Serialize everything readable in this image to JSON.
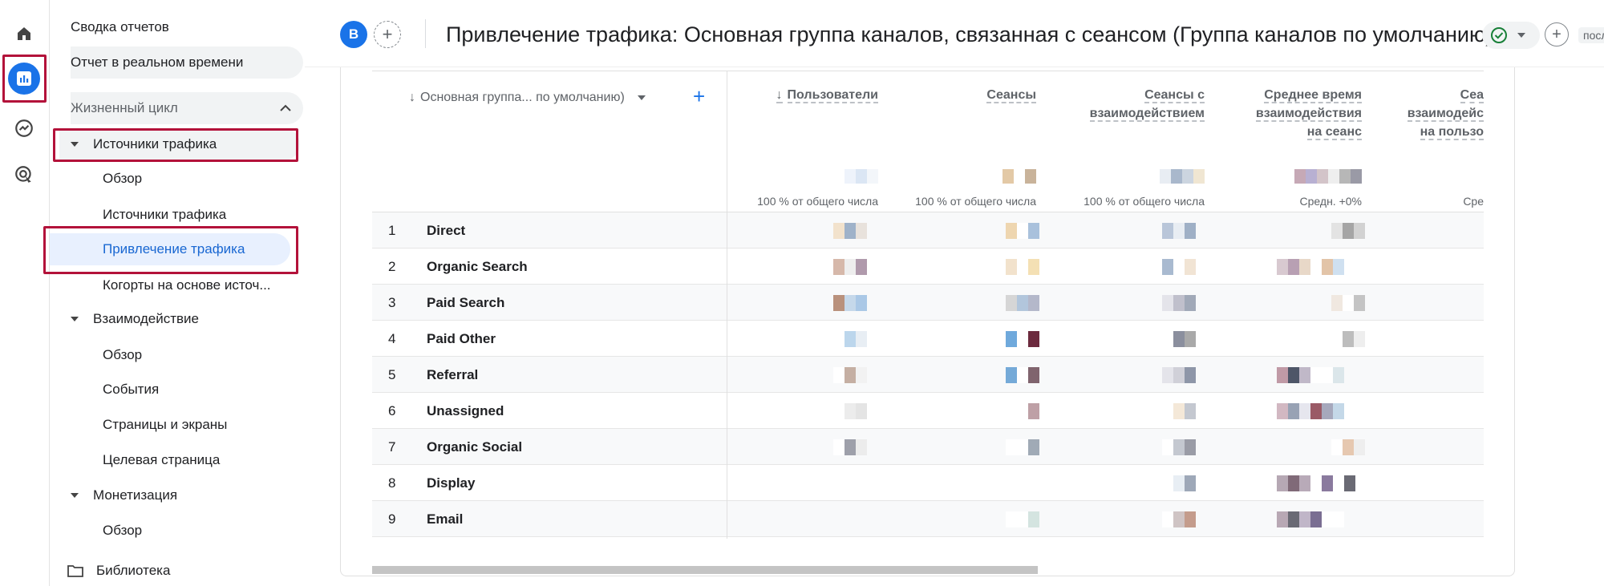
{
  "header": {
    "avatar_letter": "B",
    "title": "Привлечение трафика: Основная группа каналов, связанная с сеансом (Группа каналов по умолчанию)",
    "truncated_right": "посл"
  },
  "sidebar": {
    "top_items": [
      "Сводка отчетов",
      "Отчет в реальном времени"
    ],
    "lifecycle_label": "Жизненный цикл",
    "sections": [
      {
        "label": "Источники трафика",
        "children": [
          "Обзор",
          "Источники трафика",
          "Привлечение трафика",
          "Когорты на основе источ..."
        ]
      },
      {
        "label": "Взаимодействие",
        "children": [
          "Обзор",
          "События",
          "Страницы и экраны",
          "Целевая страница"
        ]
      },
      {
        "label": "Монетизация",
        "children": [
          "Обзор"
        ]
      }
    ],
    "library_label": "Библиотека",
    "selected_item": "Привлечение трафика"
  },
  "table": {
    "dimension_header": "Основная группа... по умолчанию)",
    "metric_columns": [
      {
        "lines": [
          "Пользователи"
        ],
        "sorted": true,
        "total": "100 % от общего числа"
      },
      {
        "lines": [
          "Сеансы"
        ],
        "sorted": false,
        "total": "100 % от общего числа"
      },
      {
        "lines": [
          "Сеансы с",
          "взаимодействием"
        ],
        "sorted": false,
        "total": "100 % от общего числа"
      },
      {
        "lines": [
          "Среднее время",
          "взаимодействия",
          "на сеанс"
        ],
        "sorted": false,
        "total": "Средн. +0%"
      },
      {
        "lines": [
          "Сеа",
          "взаимодейс",
          "на пользо"
        ],
        "sorted": false,
        "total": "Сре"
      }
    ],
    "rows": [
      {
        "index": "1",
        "name": "Direct"
      },
      {
        "index": "2",
        "name": "Organic Search"
      },
      {
        "index": "3",
        "name": "Paid Search"
      },
      {
        "index": "4",
        "name": "Paid Other"
      },
      {
        "index": "5",
        "name": "Referral"
      },
      {
        "index": "6",
        "name": "Unassigned"
      },
      {
        "index": "7",
        "name": "Organic Social"
      },
      {
        "index": "8",
        "name": "Display"
      },
      {
        "index": "9",
        "name": "Email"
      }
    ]
  },
  "colors": {
    "accent": "#1a73e8",
    "selected_bg": "#e8f0fe",
    "highlight_box": "#b3123a"
  }
}
